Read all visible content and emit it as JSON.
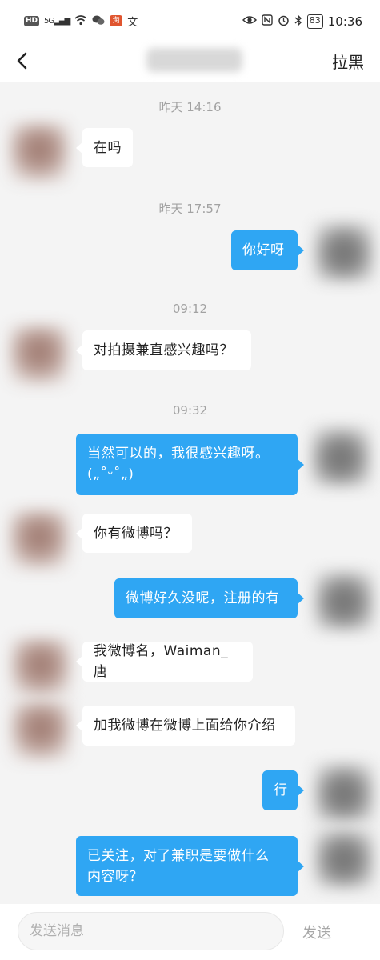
{
  "status_bar": {
    "hd": "HD",
    "network": "5G",
    "app_badge": "淘",
    "ime": "文",
    "battery": "83",
    "time": "10:36"
  },
  "nav": {
    "block_label": "拉黑"
  },
  "messages": [
    {
      "type": "time",
      "text": "昨天 14:16"
    },
    {
      "type": "in",
      "text": "在吗"
    },
    {
      "type": "time",
      "text": "昨天 17:57"
    },
    {
      "type": "out",
      "text": "你好呀"
    },
    {
      "type": "time",
      "text": "09:12"
    },
    {
      "type": "in",
      "text": "对拍摄兼直感兴趣吗？"
    },
    {
      "type": "time",
      "text": "09:32"
    },
    {
      "type": "out",
      "lines": [
        "当然可以的，我很感兴趣呀。",
        "(„˚ᵕ˚„)"
      ]
    },
    {
      "type": "in",
      "text": "你有微博吗？"
    },
    {
      "type": "out",
      "text": "微博好久没呢，注册的有"
    },
    {
      "type": "in",
      "text": "我微博名，Waiman_唐"
    },
    {
      "type": "in",
      "text": "加我微博在微博上面给你介绍"
    },
    {
      "type": "out",
      "text": "行"
    },
    {
      "type": "out",
      "lines": [
        "已关注，对了兼职是要做什么",
        "内容呀？"
      ]
    }
  ],
  "input_bar": {
    "placeholder": "发送消息",
    "send_label": "发送"
  }
}
